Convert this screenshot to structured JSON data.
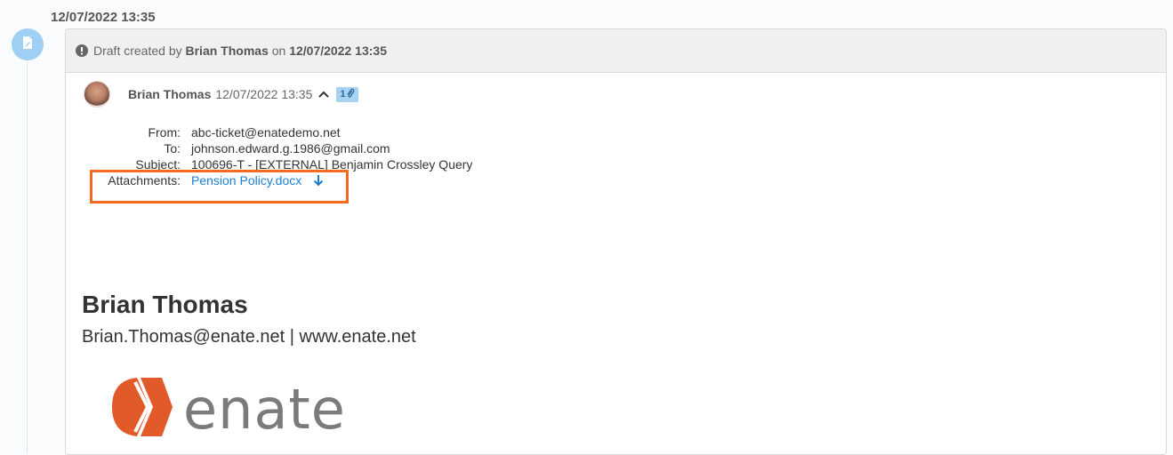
{
  "timeline": {
    "timestamp": "12/07/2022 13:35",
    "node_icon": "draft-document-icon",
    "accent_color": "#9fd0f3"
  },
  "card": {
    "header": {
      "prefix": "Draft created by",
      "author": "Brian Thomas",
      "on_word": "on",
      "datetime": "12/07/2022 13:35",
      "icon": "info-icon"
    },
    "email": {
      "sender_name": "Brian Thomas",
      "sender_date": "12/07/2022 13:35",
      "attachment_count": "1",
      "fields": {
        "from_label": "From:",
        "from_value": "abc-ticket@enatedemo.net",
        "to_label": "To:",
        "to_value": "johnson.edward.g.1986@gmail.com",
        "subject_label": "Subject:",
        "subject_value": "100696-T - [EXTERNAL] Benjamin Crossley Query",
        "attachments_label": "Attachments:",
        "attachment_name": "Pension Policy.docx"
      },
      "highlight_color": "#f26b21",
      "link_color": "#1a7fd4"
    },
    "signature": {
      "name": "Brian Thomas",
      "contact_line": "Brian.Thomas@enate.net | www.enate.net",
      "logo_text": "enate",
      "logo_color": "#e2592a"
    }
  }
}
